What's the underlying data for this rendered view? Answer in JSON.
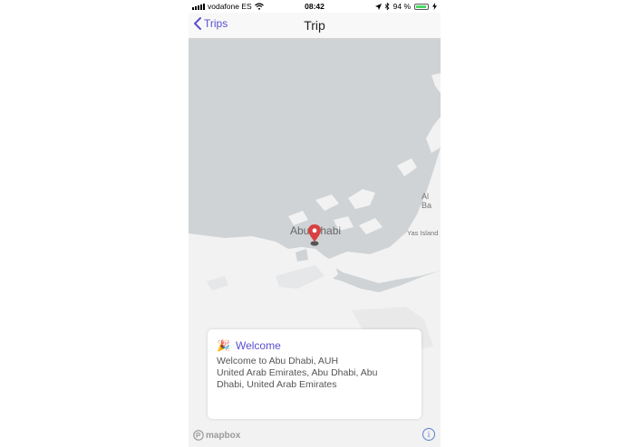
{
  "status_bar": {
    "carrier": "vodafone ES",
    "time": "08:42",
    "battery_percent": "94 %",
    "battery_level": 0.94
  },
  "nav": {
    "back_label": "Trips",
    "title": "Trip"
  },
  "map": {
    "labels": {
      "city": "Abu Dhabi",
      "island": "Yas Island",
      "al_ba": "Al Ba"
    },
    "attribution": "mapbox"
  },
  "card": {
    "emoji": "🎉",
    "title": "Welcome",
    "lines": [
      "Welcome to Abu Dhabi, AUH",
      "United Arab Emirates, Abu Dhabi, Abu",
      "Dhabi, United Arab Emirates"
    ]
  },
  "colors": {
    "accent": "#5a4fcf",
    "pin": "#d94141",
    "water": "#cfd3d5",
    "land": "#f2f2f2"
  },
  "icons": {
    "back": "chevron-left-icon",
    "wifi": "wifi-icon",
    "location": "location-arrow-icon",
    "bluetooth": "bluetooth-icon",
    "charging": "bolt-icon",
    "pin": "map-pin-icon",
    "info": "info-icon"
  }
}
